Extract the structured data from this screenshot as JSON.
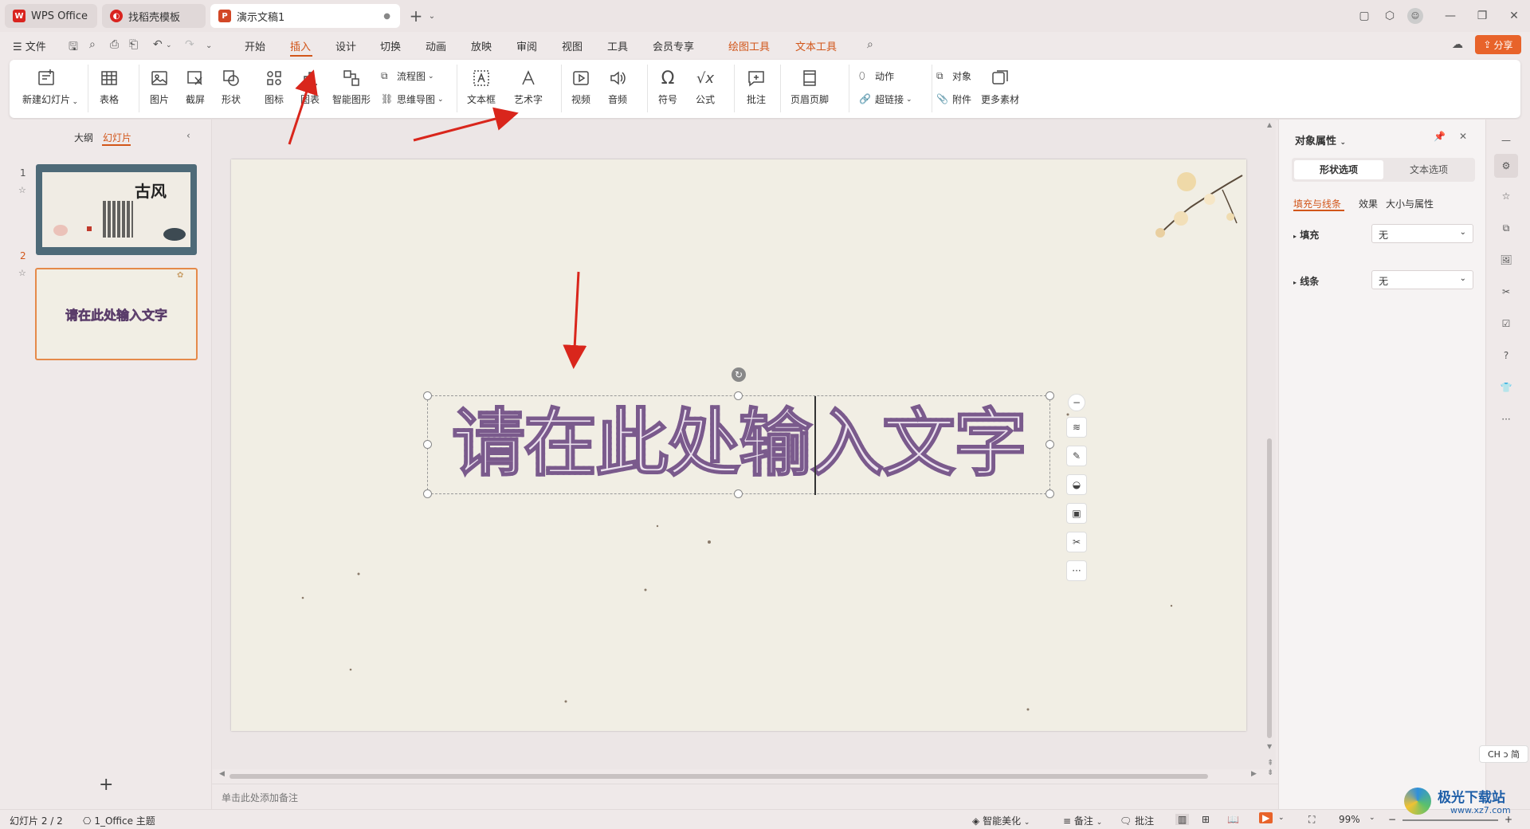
{
  "tabs": [
    {
      "label": "WPS Office"
    },
    {
      "label": "找稻壳模板"
    },
    {
      "label": "演示文稿1"
    }
  ],
  "menu": {
    "file": "文件",
    "items": [
      "开始",
      "插入",
      "设计",
      "切换",
      "动画",
      "放映",
      "审阅",
      "视图",
      "工具",
      "会员专享",
      "绘图工具",
      "文本工具"
    ],
    "active": "插入",
    "share": "分享"
  },
  "ribbon": {
    "new_slide": "新建幻灯片",
    "table": "表格",
    "picture": "图片",
    "screenshot": "截屏",
    "shape": "形状",
    "icon": "图标",
    "chart": "图表",
    "smart_art": "智能图形",
    "flowchart": "流程图",
    "mindmap": "思维导图",
    "textbox": "文本框",
    "wordart": "艺术字",
    "video": "视频",
    "audio": "音频",
    "symbol": "符号",
    "formula": "公式",
    "comment": "批注",
    "header_footer": "页眉页脚",
    "action": "动作",
    "hyperlink": "超链接",
    "object": "对象",
    "attachment": "附件",
    "more": "更多素材"
  },
  "left_panel": {
    "outline_tab": "大纲",
    "slides_tab": "幻灯片",
    "slides": [
      {
        "num": "1",
        "title_art": "古风"
      },
      {
        "num": "2",
        "text": "请在此处输入文字"
      }
    ]
  },
  "slide": {
    "wordart_text": "请在此处输入文字"
  },
  "notes_placeholder": "单击此处添加备注",
  "right_panel": {
    "title": "对象属性",
    "tab_shape": "形状选项",
    "tab_text": "文本选项",
    "subtabs": [
      "填充与线条",
      "效果",
      "大小与属性"
    ],
    "fill_label": "填充",
    "fill_value": "无",
    "line_label": "线条",
    "line_value": "无"
  },
  "ime": "CH ↄ 简",
  "status": {
    "slide_count": "幻灯片 2 / 2",
    "theme": "1_Office 主题",
    "beautify": "智能美化",
    "notes": "备注",
    "comments": "批注",
    "zoom": "99%"
  },
  "watermark": {
    "brand": "极光下载站",
    "url": "www.xz7.com"
  },
  "colors": {
    "accent": "#d2561a",
    "wordart_fill": "#9c7ba9",
    "selection": "#e58a4a"
  }
}
